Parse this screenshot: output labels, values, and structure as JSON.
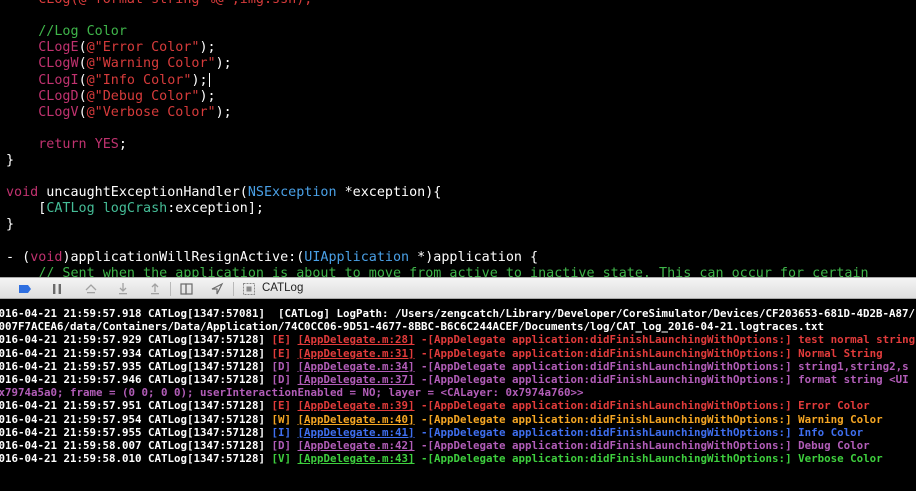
{
  "editor": {
    "lines": [
      {
        "name": "code-line-cut",
        "segments": [
          {
            "t": "    CLog(@\"format string %@\",img.ssn);",
            "c": "str"
          }
        ]
      },
      {
        "name": "code-line-blank-1",
        "segments": []
      },
      {
        "name": "code-line-comment-log-color",
        "segments": [
          {
            "t": "    //Log Color",
            "c": "cmt"
          }
        ]
      },
      {
        "name": "code-line-cloge",
        "segments": [
          {
            "t": "    ",
            "c": "pl"
          },
          {
            "t": "CLogE",
            "c": "kw"
          },
          {
            "t": "(",
            "c": "pl"
          },
          {
            "t": "@\"Error Color\"",
            "c": "str"
          },
          {
            "t": ");",
            "c": "pl"
          }
        ]
      },
      {
        "name": "code-line-clogw",
        "segments": [
          {
            "t": "    ",
            "c": "pl"
          },
          {
            "t": "CLogW",
            "c": "kw"
          },
          {
            "t": "(",
            "c": "pl"
          },
          {
            "t": "@\"Warning Color\"",
            "c": "str"
          },
          {
            "t": ");",
            "c": "pl"
          }
        ]
      },
      {
        "name": "code-line-clogi",
        "caret": true,
        "segments": [
          {
            "t": "    ",
            "c": "pl"
          },
          {
            "t": "CLogI",
            "c": "kw"
          },
          {
            "t": "(",
            "c": "pl"
          },
          {
            "t": "@\"Info Color\"",
            "c": "str"
          },
          {
            "t": ");",
            "c": "pl"
          }
        ]
      },
      {
        "name": "code-line-clogd",
        "segments": [
          {
            "t": "    ",
            "c": "pl"
          },
          {
            "t": "CLogD",
            "c": "kw"
          },
          {
            "t": "(",
            "c": "pl"
          },
          {
            "t": "@\"Debug Color\"",
            "c": "str"
          },
          {
            "t": ");",
            "c": "pl"
          }
        ]
      },
      {
        "name": "code-line-clogv",
        "segments": [
          {
            "t": "    ",
            "c": "pl"
          },
          {
            "t": "CLogV",
            "c": "kw"
          },
          {
            "t": "(",
            "c": "pl"
          },
          {
            "t": "@\"Verbose Color\"",
            "c": "str"
          },
          {
            "t": ");",
            "c": "pl"
          }
        ]
      },
      {
        "name": "code-line-blank-2",
        "segments": []
      },
      {
        "name": "code-line-return",
        "segments": [
          {
            "t": "    ",
            "c": "pl"
          },
          {
            "t": "return",
            "c": "kw"
          },
          {
            "t": " ",
            "c": "pl"
          },
          {
            "t": "YES",
            "c": "kw"
          },
          {
            "t": ";",
            "c": "pl"
          }
        ]
      },
      {
        "name": "code-line-close-brace-1",
        "segments": [
          {
            "t": "}",
            "c": "pl"
          }
        ]
      },
      {
        "name": "code-line-blank-3",
        "segments": []
      },
      {
        "name": "code-line-exception-handler",
        "segments": [
          {
            "t": "void",
            "c": "kw"
          },
          {
            "t": " uncaughtExceptionHandler(",
            "c": "pl"
          },
          {
            "t": "NSException",
            "c": "cls"
          },
          {
            "t": " *exception){",
            "c": "pl"
          }
        ]
      },
      {
        "name": "code-line-catlog-crash",
        "segments": [
          {
            "t": "    [",
            "c": "pl"
          },
          {
            "t": "CATLog",
            "c": "fn"
          },
          {
            "t": " ",
            "c": "pl"
          },
          {
            "t": "logCrash",
            "c": "fn"
          },
          {
            "t": ":exception];",
            "c": "pl"
          }
        ]
      },
      {
        "name": "code-line-close-brace-2",
        "segments": [
          {
            "t": "}",
            "c": "pl"
          }
        ]
      },
      {
        "name": "code-line-blank-4",
        "segments": []
      },
      {
        "name": "code-line-resign-active",
        "segments": [
          {
            "t": "- (",
            "c": "pl"
          },
          {
            "t": "void",
            "c": "kw"
          },
          {
            "t": ")applicationWillResignActive:(",
            "c": "pl"
          },
          {
            "t": "UIApplication",
            "c": "cls"
          },
          {
            "t": " *)application {",
            "c": "pl"
          }
        ]
      },
      {
        "name": "code-line-comment-sent",
        "segments": [
          {
            "t": "    // Sent when the application is about to move from active to inactive state. This can occur for certain",
            "c": "cmt"
          }
        ]
      }
    ]
  },
  "debug_bar": {
    "target_label": "CATLog",
    "icons": [
      "breakpoint-icon",
      "pause-icon",
      "step-over-icon",
      "step-into-icon",
      "step-out-icon",
      "view-hierarchy-icon",
      "location-icon",
      "target-icon"
    ]
  },
  "console": {
    "lines": [
      {
        "name": "log-line-path",
        "segments": [
          {
            "t": "2016-04-21 21:59:57.918 CATLog[1347:57081]  [CATLog] LogPath: /Users/zengcatch/Library/Developer/CoreSimulator/Devices/CF203653-681D-4D2B-A87/",
            "c": "#ffffff"
          }
        ]
      },
      {
        "name": "log-line-path-cont",
        "segments": [
          {
            "t": "B007F7ACEA6/data/Containers/Data/Application/74C0CC06-9D51-4677-8BBC-B6C6C244ACEF/Documents/log/CAT_log_2016-04-21.logtraces.txt",
            "c": "#ffffff"
          }
        ]
      },
      {
        "name": "log-line-error-1",
        "segments": [
          {
            "t": "2016-04-21 21:59:57.929 CATLog[1347:57128] ",
            "c": "#ffffff"
          },
          {
            "t": "[E] ",
            "c": "#e23b3b"
          },
          {
            "t": "[AppDelegate.m:28]",
            "c": "#e23b3b",
            "u": true
          },
          {
            "t": " -[AppDelegate application:didFinishLaunchingWithOptions:] test normal string",
            "c": "#e23b3b"
          }
        ]
      },
      {
        "name": "log-line-error-2",
        "segments": [
          {
            "t": "2016-04-21 21:59:57.934 CATLog[1347:57128] ",
            "c": "#ffffff"
          },
          {
            "t": "[E] ",
            "c": "#e23b3b"
          },
          {
            "t": "[AppDelegate.m:31]",
            "c": "#e23b3b",
            "u": true
          },
          {
            "t": " -[AppDelegate application:didFinishLaunchingWithOptions:] Normal String",
            "c": "#e23b3b"
          }
        ]
      },
      {
        "name": "log-line-debug-1",
        "segments": [
          {
            "t": "2016-04-21 21:59:57.935 CATLog[1347:57128] ",
            "c": "#ffffff"
          },
          {
            "t": "[D] ",
            "c": "#b25db8"
          },
          {
            "t": "[AppDelegate.m:34]",
            "c": "#b25db8",
            "u": true
          },
          {
            "t": " -[AppDelegate application:didFinishLaunchingWithOptions:] string1,string2,s",
            "c": "#b25db8"
          }
        ]
      },
      {
        "name": "log-line-debug-2",
        "segments": [
          {
            "t": "2016-04-21 21:59:57.946 CATLog[1347:57128] ",
            "c": "#ffffff"
          },
          {
            "t": "[D] ",
            "c": "#b25db8"
          },
          {
            "t": "[AppDelegate.m:37]",
            "c": "#b25db8",
            "u": true
          },
          {
            "t": " -[AppDelegate application:didFinishLaunchingWithOptions:] format string <UI",
            "c": "#b25db8"
          }
        ]
      },
      {
        "name": "log-line-debug-2-cont",
        "segments": [
          {
            "t": "0x7974a5a0; frame = (0 0; 0 0); userInteractionEnabled = NO; layer = <CALayer: 0x7974a760>>",
            "c": "#b25db8"
          }
        ]
      },
      {
        "name": "log-line-error-color",
        "segments": [
          {
            "t": "2016-04-21 21:59:57.951 CATLog[1347:57128] ",
            "c": "#ffffff"
          },
          {
            "t": "[E] ",
            "c": "#e23b3b"
          },
          {
            "t": "[AppDelegate.m:39]",
            "c": "#e23b3b",
            "u": true
          },
          {
            "t": " -[AppDelegate application:didFinishLaunchingWithOptions:] Error Color",
            "c": "#e23b3b"
          }
        ]
      },
      {
        "name": "log-line-warning-color",
        "segments": [
          {
            "t": "2016-04-21 21:59:57.954 CATLog[1347:57128] ",
            "c": "#ffffff"
          },
          {
            "t": "[W] ",
            "c": "#f5a623"
          },
          {
            "t": "[AppDelegate.m:40]",
            "c": "#f5a623",
            "u": true
          },
          {
            "t": " -[AppDelegate application:didFinishLaunchingWithOptions:] Warning Color",
            "c": "#f5a623"
          }
        ]
      },
      {
        "name": "log-line-info-color",
        "segments": [
          {
            "t": "2016-04-21 21:59:57.955 CATLog[1347:57128] ",
            "c": "#ffffff"
          },
          {
            "t": "[I] ",
            "c": "#3f6ff0"
          },
          {
            "t": "[AppDelegate.m:41]",
            "c": "#3f6ff0",
            "u": true
          },
          {
            "t": " -[AppDelegate application:didFinishLaunchingWithOptions:] Info Color",
            "c": "#3f6ff0"
          }
        ]
      },
      {
        "name": "log-line-debug-color",
        "segments": [
          {
            "t": "2016-04-21 21:59:58.007 CATLog[1347:57128] ",
            "c": "#ffffff"
          },
          {
            "t": "[D] ",
            "c": "#b25db8"
          },
          {
            "t": "[AppDelegate.m:42]",
            "c": "#b25db8",
            "u": true
          },
          {
            "t": " -[AppDelegate application:didFinishLaunchingWithOptions:] Debug Color",
            "c": "#b25db8"
          }
        ]
      },
      {
        "name": "log-line-verbose-color",
        "segments": [
          {
            "t": "2016-04-21 21:59:58.010 CATLog[1347:57128] ",
            "c": "#ffffff"
          },
          {
            "t": "[V] ",
            "c": "#3ecf3e"
          },
          {
            "t": "[AppDelegate.m:43]",
            "c": "#3ecf3e",
            "u": true
          },
          {
            "t": " -[AppDelegate application:didFinishLaunchingWithOptions:] Verbose Color",
            "c": "#3ecf3e"
          }
        ]
      }
    ]
  }
}
